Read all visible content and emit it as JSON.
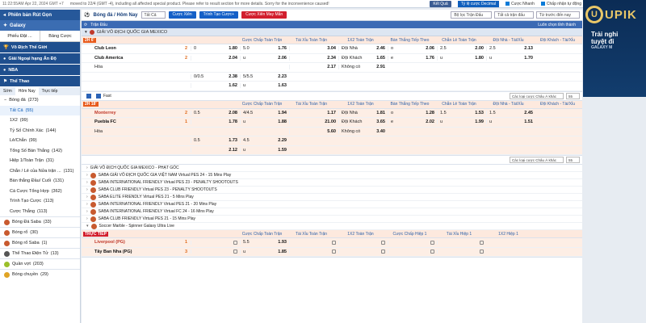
{
  "topbar": {
    "time": "11:22:55AM Apr 22, 2024 GMT +7",
    "notice": "moved to 22/4 (GMT -4), including all affected special product. Please refer to result section for more details. Sorry for the inconvenience caused!",
    "btn_result": "Kết Quả",
    "odds_select": "Tỷ lệ cược Decimal",
    "chk_fast": "Cược Nhanh",
    "chk_auto": "Chấp nhận tự động"
  },
  "sidebar": {
    "header": "Phiên bản Rút Gọn",
    "galaxy": "Galaxy",
    "tabs": [
      "Phiếu Đặt ...",
      "Bảng Cược"
    ],
    "sections": [
      "Vô Địch Thế Giới",
      "Giải Ngoại hạng Ấn Độ",
      "NBA",
      "Thể Thao"
    ],
    "subtabs": [
      "Sớm",
      "Hôm Nay",
      "Trực tiếp"
    ],
    "items": [
      {
        "label": "Bóng đá",
        "count": "(273)"
      },
      {
        "label": "Tất Cả",
        "count": "(55)"
      },
      {
        "label": "1X2",
        "count": "(99)"
      },
      {
        "label": "Tỷ Số Chính Xác",
        "count": "(144)"
      },
      {
        "label": "Lẻ/Chẵn",
        "count": "(99)"
      },
      {
        "label": "Tổng Số Bàn Thắng",
        "count": "(142)"
      },
      {
        "label": "Hiệp 1/Toàn Trận",
        "count": "(31)"
      },
      {
        "label": "Chẵn / Lẻ của Nửa trận ...",
        "count": "(131)"
      },
      {
        "label": "Bàn thắng Đầu/ Cuối",
        "count": "(131)"
      },
      {
        "label": "Cá Cược Tổng Hợp",
        "count": "(362)"
      },
      {
        "label": "Trình Tạo Cược",
        "count": "(113)"
      },
      {
        "label": "Cược Thắng",
        "count": "(113)"
      }
    ],
    "sports": [
      {
        "label": "Bóng Đá Saba",
        "count": "(33)"
      },
      {
        "label": "Bóng rổ",
        "count": "(30)"
      },
      {
        "label": "Bóng rổ Saba",
        "count": "(1)"
      },
      {
        "label": "Thể Thao Điện Tử",
        "count": "(13)"
      },
      {
        "label": "Quần vợt",
        "count": "(203)"
      },
      {
        "label": "Bóng chuyền",
        "count": "(29)"
      }
    ]
  },
  "main": {
    "title": "Bóng đá / Hôm Nay",
    "filter": "Tất Cả",
    "tabs": [
      "Cược Xiên",
      "Trình Tạo Cược+",
      "Cược Xiên May Mắn"
    ],
    "right_filters": [
      "Bộ lọc Trận Đấu",
      "Tất cả trận đấu",
      "Từ trước đến nay"
    ],
    "section_label": "Trận Đấu",
    "section_right": "Luôn chọn tỉnh thành",
    "league1": "GIẢI VÔ ĐỊCH QUỐC GIA MEXICO",
    "cols": [
      "Cược Chấp Toàn Trận",
      "Tài Xỉu Toàn Trận",
      "1X2 Toàn Trận",
      "Bàn Thắng Tiếp Theo",
      "Chẵn Lẻ Toàn Trận",
      "Đội Nhà - Tài/Xỉu",
      "Đội Khách - Tài/Xỉu"
    ],
    "m1": {
      "badge": "2H 6'",
      "home": "Club Leon",
      "away": "Club America",
      "draw": "Hòa",
      "hs": "2",
      "as": "2",
      "r1": [
        "0",
        "1.80",
        "5.0",
        "1.76",
        "3.04",
        "Đội Nhà",
        "2.46",
        "o",
        "2.06",
        "2.5",
        "2.00",
        "2.5",
        "2.13"
      ],
      "r2": [
        "",
        "2.04",
        "u",
        "2.06",
        "2.34",
        "Đội Khách",
        "1.65",
        "e",
        "1.76",
        "u",
        "1.80",
        "u",
        "1.70"
      ],
      "r3": [
        "",
        "",
        "",
        "",
        "2.17",
        "Không có",
        "2.91"
      ],
      "r4": [
        "0/0.5",
        "2.38",
        "5/5.5",
        "2.23"
      ],
      "r5": [
        "",
        "1.62",
        "u",
        "1.63"
      ]
    },
    "toolbar": {
      "fast": "Fast",
      "sort": "Các loại cược Châu Á khác",
      "num": "55"
    },
    "m2": {
      "badge": "2H 18'",
      "home": "Monterrey",
      "away": "Puebla FC",
      "draw": "Hòa",
      "hs": "2",
      "as": "1",
      "r1": [
        "0.5",
        "2.08",
        "4/4.5",
        "1.94",
        "1.17",
        "Đội Nhà",
        "1.81",
        "o",
        "1.28",
        "1.5",
        "1.53",
        "1.5",
        "2.45"
      ],
      "r2": [
        "",
        "1.78",
        "u",
        "1.88",
        "21.00",
        "Đội Khách",
        "3.65",
        "e",
        "2.02",
        "u",
        "1.99",
        "u",
        "1.51"
      ],
      "r3": [
        "",
        "",
        "",
        "",
        "5.60",
        "Không có",
        "3.40"
      ],
      "r4": [
        "0.5",
        "1.73",
        "4.5",
        "2.29"
      ],
      "r5": [
        "",
        "2.12",
        "u",
        "1.59"
      ]
    },
    "leagues": [
      "GIẢI VÔ ĐỊCH QUỐC GIA MEXICO - PHẠT GÓC",
      "SABA GIẢI VÔ ĐỊCH QUỐC GIA VIỆT NAM Virtual PES 24 - 15 Mins Play",
      "SABA INTERNATIONAL FRIENDLY Virtual PES 23 - PENALTY SHOOTOUTS",
      "SABA CLUB FRIENDLY Virtual PES 23 - PENALTY SHOOTOUTS",
      "SABA ELITE FRIENDLY Virtual PES 21 - 5 Mins Play",
      "SABA INTERNATIONAL FRIENDLY Virtual PES 21 - 20 Mins Play",
      "SABA INTERNATIONAL FRIENDLY Virtual FC 24 - 16 Mins Play",
      "SABA CLUB FRIENDLY Virtual PES 21 - 15 Mins Play",
      "Soccer Marble - Spinner Galaxy Ultra Live"
    ],
    "live_label": "TRỰC TIẾP",
    "cols2": [
      "Cược Chấp Toàn Trận",
      "Tài Xỉu Toàn Trận",
      "1X2 Toàn Trận",
      "Cược Chấp Hiệp 1",
      "Tài Xỉu Hiệp 1",
      "1X2 Hiệp 1"
    ],
    "m3": {
      "home": "Liverpool (PG)",
      "away": "Tây Ban Nha (PG)",
      "hs": "1",
      "as": "3",
      "r1": [
        "",
        "",
        "5.5",
        "1.93"
      ],
      "r2": [
        "",
        "",
        "u",
        "1.85"
      ]
    }
  },
  "banner": {
    "logo": "UPIK",
    "line1": "Trải nghi",
    "line2": "tuyệt đỉ",
    "sub": "GALAXY M"
  }
}
